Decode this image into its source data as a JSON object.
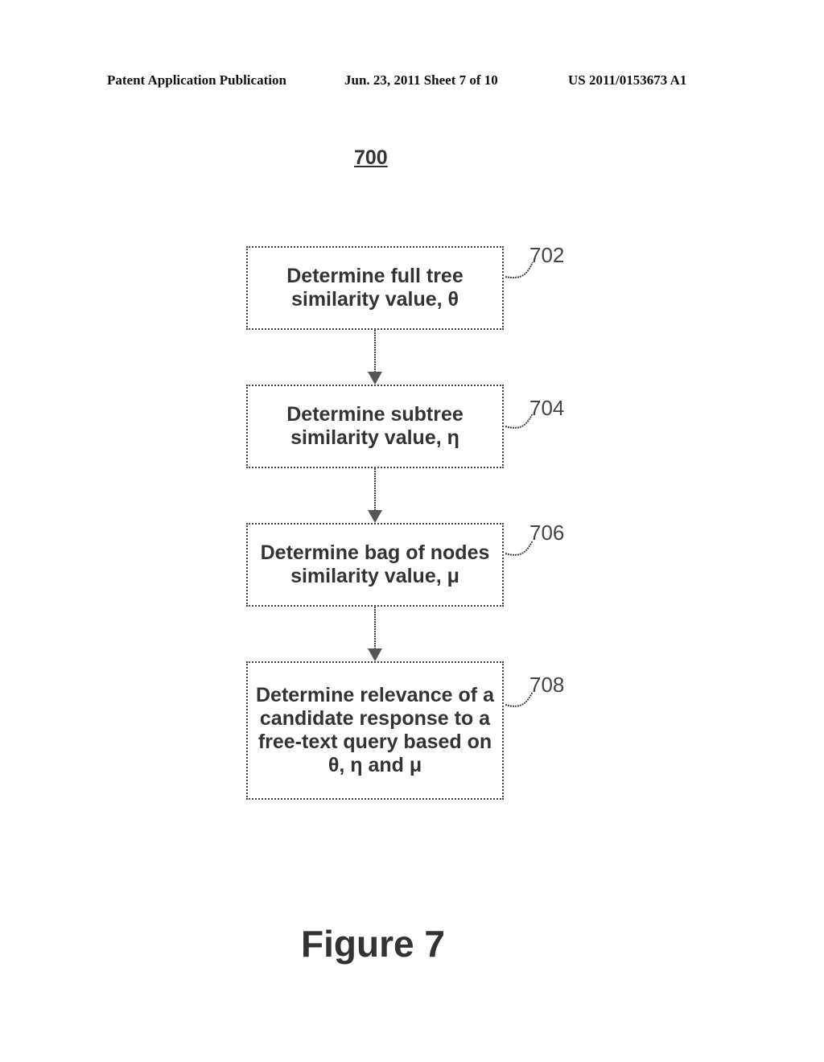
{
  "header": {
    "left": "Patent Application Publication",
    "middle": "Jun. 23, 2011  Sheet 7 of 10",
    "right": "US 2011/0153673 A1"
  },
  "diagram": {
    "figure_number": "700",
    "caption": "Figure 7",
    "steps": [
      {
        "ref": "702",
        "text": "Determine full tree similarity value, θ"
      },
      {
        "ref": "704",
        "text": "Determine subtree similarity value, η"
      },
      {
        "ref": "706",
        "text": "Determine bag of nodes similarity value, μ"
      },
      {
        "ref": "708",
        "text": "Determine relevance of a candidate response to a free-text query based on θ, η and μ"
      }
    ],
    "flow": [
      "702 → 704",
      "704 → 706",
      "706 → 708"
    ]
  }
}
